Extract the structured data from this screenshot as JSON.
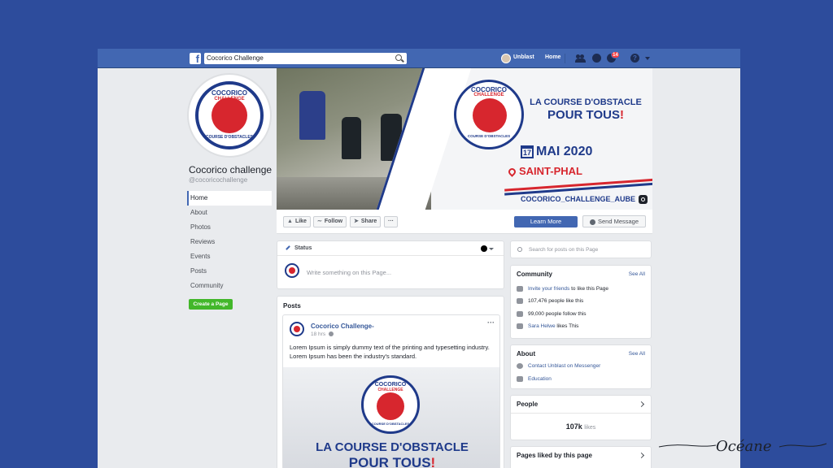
{
  "topbar": {
    "search_value": "Cocorico Challenge",
    "user_name": "Unblast",
    "home_label": "Home",
    "notification_count": "14",
    "help_glyph": "?"
  },
  "page": {
    "name": "Cocorico challenge",
    "handle": "@cocoricochallenge",
    "logo_top": "COCORICO",
    "logo_mid": "CHALLENGE",
    "logo_bottom": "COURSE D'OBSTACLES"
  },
  "sidebar": {
    "items": [
      {
        "label": "Home",
        "active": true
      },
      {
        "label": "About"
      },
      {
        "label": "Photos"
      },
      {
        "label": "Reviews"
      },
      {
        "label": "Events"
      },
      {
        "label": "Posts"
      },
      {
        "label": "Community"
      }
    ],
    "create_label": "Create a Page"
  },
  "cover": {
    "headline_1": "LA COURSE D'OBSTACLE",
    "headline_2": "POUR TOUS",
    "headline_2_mark": "!",
    "date_day": "17",
    "date_rest": "MAI 2020",
    "place": "SAINT-PHAL",
    "instagram": "COCORICO_CHALLENGE_AUBE"
  },
  "actions": {
    "like": "Like",
    "follow": "Follow",
    "share": "Share",
    "more": "···",
    "learn_more": "Learn More",
    "send_message": "Send Message"
  },
  "status": {
    "title": "Status",
    "placeholder": "Write something on this Page..."
  },
  "posts": {
    "title": "Posts",
    "author": "Cocorico Challenge-",
    "time": "18 hrs",
    "menu": "···",
    "text": "Lorem Ipsum is simply dummy text of the printing and typesetting industry. Lorem Ipsum has been the industry's standard.",
    "img_h1": "LA COURSE D'OBSTACLE",
    "img_h2": "POUR TOUS",
    "img_h2_mark": "!"
  },
  "right": {
    "search_placeholder": "Search for posts on this Page",
    "community_title": "Community",
    "see_all": "See All",
    "invite_link": "Invite your friends",
    "invite_rest": "to like this Page",
    "likes": "107,476 people like this",
    "follows": "99,000 people follow this",
    "friend_name": "Sara Helwe",
    "friend_rest": "likes This",
    "about_title": "About",
    "contact": "Contact Unblast on Messenger",
    "category": "Education",
    "people_title": "People",
    "people_count": "107k",
    "people_unit": "likes",
    "pages_liked_title": "Pages liked by this page"
  },
  "signature": "Océane",
  "colors": {
    "background": "#2d4c9c",
    "fb_blue": "#4267b2",
    "brand_navy": "#1f3a8a",
    "brand_red": "#d7262e",
    "create_green": "#42b72a"
  }
}
